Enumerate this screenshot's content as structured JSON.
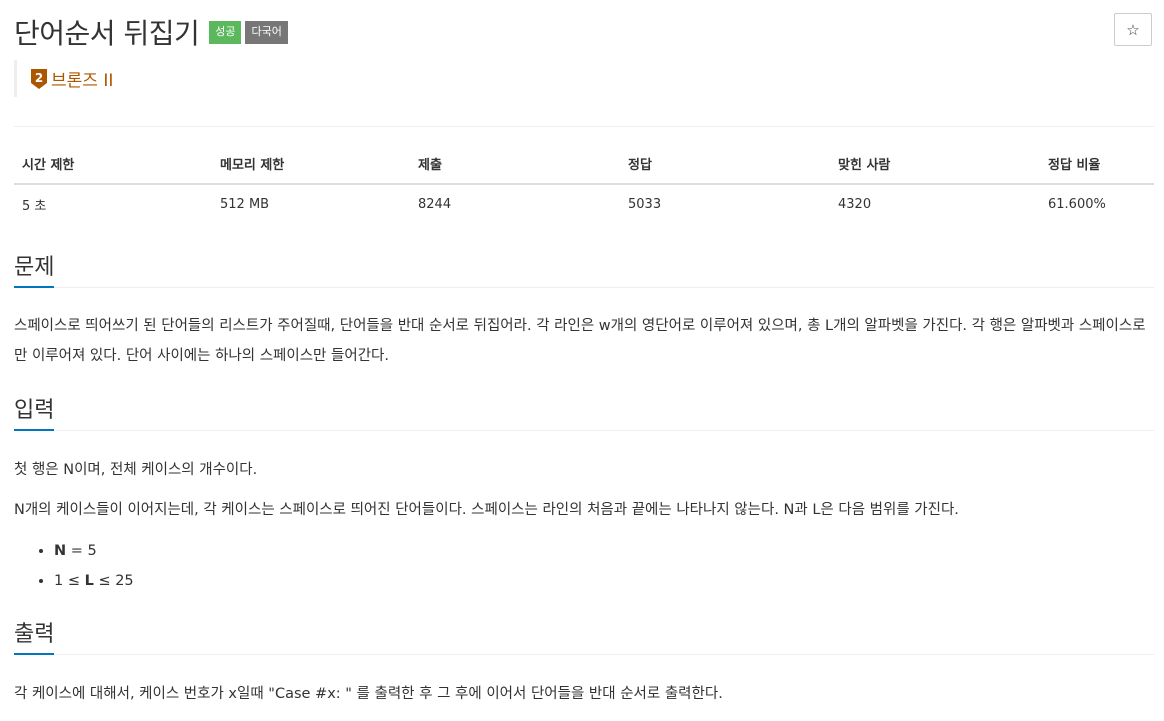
{
  "problem": {
    "title": "단어순서 뒤집기",
    "badges": [
      "성공",
      "다국어"
    ],
    "tier": "브론즈 II",
    "tier_number": "2",
    "tier_color": "#ad5600"
  },
  "toolbar": {
    "star_icon": "☆"
  },
  "info_table": {
    "headers": [
      "시간 제한",
      "메모리 제한",
      "제출",
      "정답",
      "맞힌 사람",
      "정답 비율"
    ],
    "values": [
      "5 초",
      "512 MB",
      "8244",
      "5033",
      "4320",
      "61.600%"
    ]
  },
  "sections": {
    "problem": {
      "heading": "문제",
      "text": "스페이스로 띄어쓰기 된 단어들의 리스트가 주어질때, 단어들을 반대 순서로 뒤집어라. 각 라인은 w개의 영단어로 이루어져 있으며, 총 L개의 알파벳을 가진다. 각 행은 알파벳과 스페이스로만 이루어져 있다. 단어 사이에는 하나의 스페이스만 들어간다."
    },
    "input": {
      "heading": "입력",
      "line1": "첫 행은 N이며, 전체 케이스의 개수이다.",
      "line2": "N개의 케이스들이 이어지는데, 각 케이스는 스페이스로 띄어진 단어들이다. 스페이스는 라인의 처음과 끝에는 나타나지 않는다. N과 L은 다음 범위를 가진다.",
      "limits": [
        {
          "pre": "",
          "var": "N",
          "post": " = 5"
        },
        {
          "pre": "1 ≤ ",
          "var": "L",
          "post": " ≤ 25"
        }
      ]
    },
    "output": {
      "heading": "출력",
      "text": "각 케이스에 대해서, 케이스 번호가 x일때  \"Case #x: \" 를 출력한 후 그 후에 이어서 단어들을 반대 순서로 출력한다."
    }
  },
  "colors": {
    "success": "#5cb85c",
    "multi": "#777777",
    "accent": "#0076c0"
  }
}
